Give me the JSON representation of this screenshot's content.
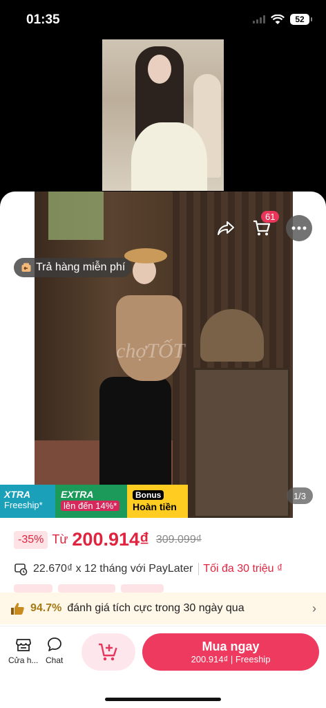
{
  "status_bar": {
    "time": "01:35",
    "battery": "52"
  },
  "product_image": {
    "watermark": "chợTỐT",
    "return_label": "Trả hàng miễn phí",
    "counter": "1/3",
    "cart_count": "61"
  },
  "promos": [
    {
      "title": "XTRA",
      "sub": "Freeship*"
    },
    {
      "title": "EXTRA",
      "sub": "lên đến 14%*"
    },
    {
      "title": "Bonus",
      "sub": "Hoàn tiền"
    }
  ],
  "price": {
    "discount": "-35%",
    "from": "Từ",
    "current": "200.914₫",
    "original": "309.099₫"
  },
  "paylater": {
    "text": "22.670₫ x 12 tháng với PayLater",
    "limit": "Tối đa 30 triệu ₫"
  },
  "rating": {
    "percent": "94.7%",
    "text": "đánh giá tích cực trong 30 ngày qua"
  },
  "bottom_bar": {
    "shop_label": "Cửa h...",
    "chat_label": "Chat",
    "buy_label": "Mua ngay",
    "buy_sub": "200.914₫ | Freeship"
  },
  "colors": {
    "accent": "#ee3a5e",
    "price": "#e0243f"
  }
}
